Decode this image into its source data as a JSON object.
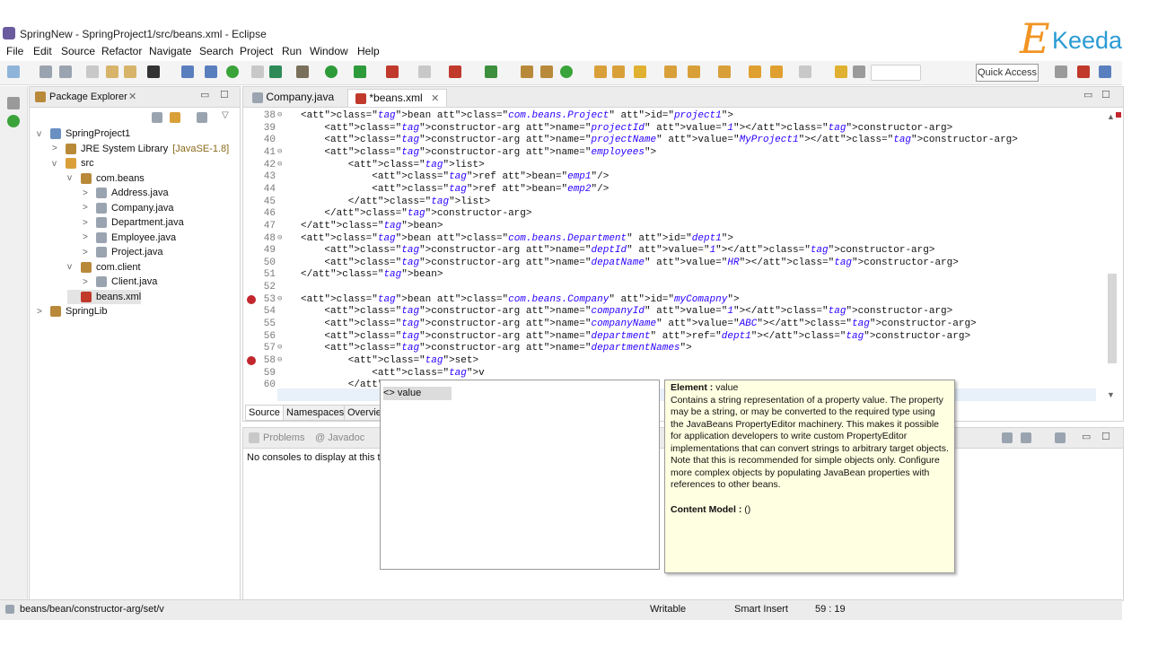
{
  "window": {
    "title": "SpringNew - SpringProject1/src/beans.xml - Eclipse"
  },
  "brand": {
    "logo_e": "E",
    "logo_k": "Keeda"
  },
  "menu": [
    "File",
    "Edit",
    "Source",
    "Refactor",
    "Navigate",
    "Search",
    "Project",
    "Run",
    "Window",
    "Help"
  ],
  "toolbar": {
    "quick_access": "Quick Access"
  },
  "package_explorer": {
    "title": "Package Explorer",
    "tree": [
      {
        "label": "SpringProject1",
        "level": 0,
        "twisty": "v",
        "icon": "project-icon"
      },
      {
        "label": "JRE System Library",
        "extra": "[JavaSE-1.8]",
        "level": 1,
        "twisty": ">",
        "icon": "library-icon"
      },
      {
        "label": "src",
        "level": 1,
        "twisty": "v",
        "icon": "source-folder-icon"
      },
      {
        "label": "com.beans",
        "level": 2,
        "twisty": "v",
        "icon": "package-icon"
      },
      {
        "label": "Address.java",
        "level": 3,
        "twisty": ">",
        "icon": "java-file-icon"
      },
      {
        "label": "Company.java",
        "level": 3,
        "twisty": ">",
        "icon": "java-file-icon"
      },
      {
        "label": "Department.java",
        "level": 3,
        "twisty": ">",
        "icon": "java-file-icon"
      },
      {
        "label": "Employee.java",
        "level": 3,
        "twisty": ">",
        "icon": "java-file-icon"
      },
      {
        "label": "Project.java",
        "level": 3,
        "twisty": ">",
        "icon": "java-file-icon"
      },
      {
        "label": "com.client",
        "level": 2,
        "twisty": "v",
        "icon": "package-icon"
      },
      {
        "label": "Client.java",
        "level": 3,
        "twisty": ">",
        "icon": "java-file-icon"
      },
      {
        "label": "beans.xml",
        "level": 2,
        "twisty": "",
        "icon": "xml-file-icon"
      },
      {
        "label": "SpringLib",
        "level": 0,
        "twisty": ">",
        "icon": "library-icon"
      }
    ]
  },
  "editor": {
    "tabs": [
      {
        "label": "Company.java"
      },
      {
        "label": "*beans.xml"
      }
    ],
    "lines": [
      {
        "n": "38",
        "fold": "⊖",
        "text": "<bean class=\"com.beans.Project\" id=\"project1\">"
      },
      {
        "n": "39",
        "text": "    <constructor-arg name=\"projectId\" value=\"1\"></constructor-arg>"
      },
      {
        "n": "40",
        "text": "    <constructor-arg name=\"projectName\" value=\"MyProject1\"></constructor-arg>"
      },
      {
        "n": "41",
        "fold": "⊖",
        "text": "    <constructor-arg name=\"employees\">"
      },
      {
        "n": "42",
        "fold": "⊖",
        "text": "        <list>"
      },
      {
        "n": "43",
        "text": "            <ref bean=\"emp1\"/>"
      },
      {
        "n": "44",
        "text": "            <ref bean=\"emp2\"/>"
      },
      {
        "n": "45",
        "text": "        </list>"
      },
      {
        "n": "46",
        "text": "    </constructor-arg>"
      },
      {
        "n": "47",
        "text": "</bean>"
      },
      {
        "n": "48",
        "fold": "⊖",
        "text": "<bean class=\"com.beans.Department\" id=\"dept1\">"
      },
      {
        "n": "49",
        "text": "    <constructor-arg name=\"deptId\" value=\"1\"></constructor-arg>"
      },
      {
        "n": "50",
        "text": "    <constructor-arg name=\"depatName\" value=\"HR\"></constructor-arg>"
      },
      {
        "n": "51",
        "text": "</bean>"
      },
      {
        "n": "52",
        "text": ""
      },
      {
        "n": "53",
        "fold": "⊖",
        "error": true,
        "text": "<bean class=\"com.beans.Company\" id=\"myComapny\">"
      },
      {
        "n": "54",
        "text": "    <constructor-arg name=\"companyId\" value=\"1\"></constructor-arg>"
      },
      {
        "n": "55",
        "text": "    <constructor-arg name=\"companyName\" value=\"ABC\"></constructor-arg>"
      },
      {
        "n": "56",
        "text": "    <constructor-arg name=\"department\" ref=\"dept1\"></constructor-arg>"
      },
      {
        "n": "57",
        "fold": "⊖",
        "text": "    <constructor-arg name=\"departmentNames\">"
      },
      {
        "n": "58",
        "fold": "⊖",
        "error": true,
        "text": "        <set>"
      },
      {
        "n": "59",
        "text": "            <v"
      },
      {
        "n": "60",
        "text": "        </set>"
      }
    ],
    "bottom_tabs": [
      "Source",
      "Namespaces",
      "Overvie"
    ]
  },
  "console": {
    "tabs": [
      "Problems",
      "@ Javadoc"
    ],
    "message": "No consoles to display at this ti"
  },
  "content_assist": {
    "item": "<> value"
  },
  "tooltip": {
    "element_label": "Element :",
    "element_value": "value",
    "description": "Contains a string representation of a property value. The property may be a string, or may be converted to the required type using the JavaBeans PropertyEditor machinery. This makes it possible for application developers to write custom PropertyEditor implementations that can convert strings to arbitrary target objects. Note that this is recommended for simple objects only. Configure more complex objects by populating JavaBean properties with references to other beans.",
    "content_model_label": "Content Model :",
    "content_model_value": "()"
  },
  "status": {
    "path": "beans/bean/constructor-arg/set/v",
    "writable": "Writable",
    "insert_mode": "Smart Insert",
    "position": "59 : 19"
  }
}
